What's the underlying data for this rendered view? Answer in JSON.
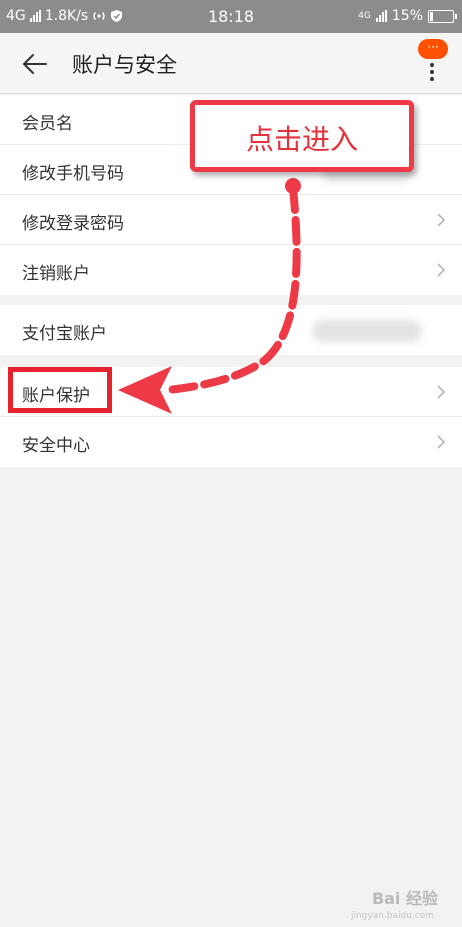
{
  "status_bar": {
    "network_left": "4G",
    "speed": "1.8K/s",
    "time": "18:18",
    "network_right": "4G",
    "battery": "15%",
    "battery_level": 0.15
  },
  "header": {
    "title": "账户与安全",
    "badge": "···"
  },
  "group1": [
    {
      "label": "会员名",
      "has_chevron": false
    },
    {
      "label": "修改手机号码",
      "has_chevron": false
    },
    {
      "label": "修改登录密码",
      "has_chevron": true
    },
    {
      "label": "注销账户",
      "has_chevron": true
    }
  ],
  "group2": [
    {
      "label": "支付宝账户",
      "has_chevron": false
    }
  ],
  "group3": [
    {
      "label": "账户保护",
      "has_chevron": true
    },
    {
      "label": "安全中心",
      "has_chevron": true
    }
  ],
  "annotation": {
    "callout": "点击进入",
    "color": "#e4232f"
  },
  "watermark": {
    "brand": "Bai 经验",
    "url": "jingyan.baidu.com"
  }
}
